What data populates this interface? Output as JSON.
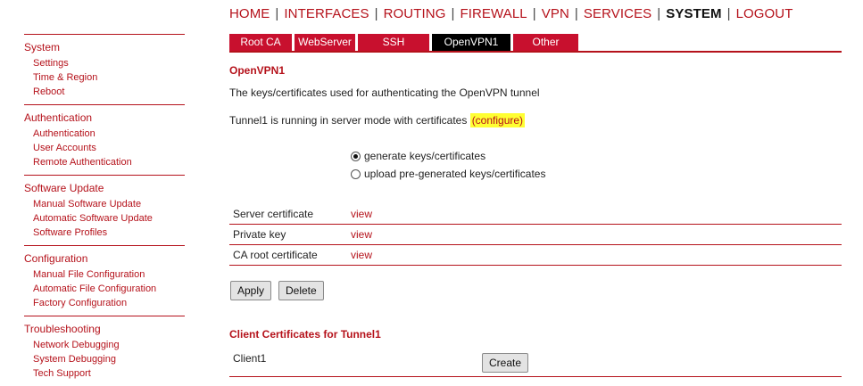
{
  "topnav": {
    "items": [
      "HOME",
      "INTERFACES",
      "ROUTING",
      "FIREWALL",
      "VPN",
      "SERVICES",
      "SYSTEM",
      "LOGOUT"
    ],
    "separator": "|",
    "active": "SYSTEM"
  },
  "sidebar": {
    "sections": [
      {
        "title": "System",
        "items": [
          "Settings",
          "Time & Region",
          "Reboot"
        ]
      },
      {
        "title": "Authentication",
        "items": [
          "Authentication",
          "User Accounts",
          "Remote Authentication"
        ]
      },
      {
        "title": "Software Update",
        "items": [
          "Manual Software Update",
          "Automatic Software Update",
          "Software Profiles"
        ]
      },
      {
        "title": "Configuration",
        "items": [
          "Manual File Configuration",
          "Automatic File Configuration",
          "Factory Configuration"
        ]
      },
      {
        "title": "Troubleshooting",
        "items": [
          "Network Debugging",
          "System Debugging",
          "Tech Support"
        ]
      }
    ]
  },
  "tabs": {
    "items": [
      "Root CA",
      "WebServer",
      "SSH",
      "OpenVPN1",
      "Other"
    ],
    "active": "OpenVPN1"
  },
  "main": {
    "title": "OpenVPN1",
    "description": "The keys/certificates used for authenticating the OpenVPN tunnel",
    "tunnel_text": "Tunnel1 is running in server mode with certificates ",
    "configure_link": "(configure)",
    "radio_generate": "generate keys/certificates",
    "radio_upload": "upload pre-generated keys/certificates",
    "selected_radio": "generate"
  },
  "certificates": [
    {
      "label": "Server certificate",
      "link": "view"
    },
    {
      "label": "Private key",
      "link": "view"
    },
    {
      "label": "CA root certificate",
      "link": "view"
    }
  ],
  "buttons": {
    "apply": "Apply",
    "delete": "Delete",
    "create": "Create"
  },
  "clients": {
    "title": "Client Certificates for Tunnel1",
    "items": [
      "Client1"
    ]
  },
  "colors": {
    "accent": "#b5121b",
    "tab_bg": "#c8102e",
    "tab_active_bg": "#000000",
    "highlight": "#ffff33"
  }
}
